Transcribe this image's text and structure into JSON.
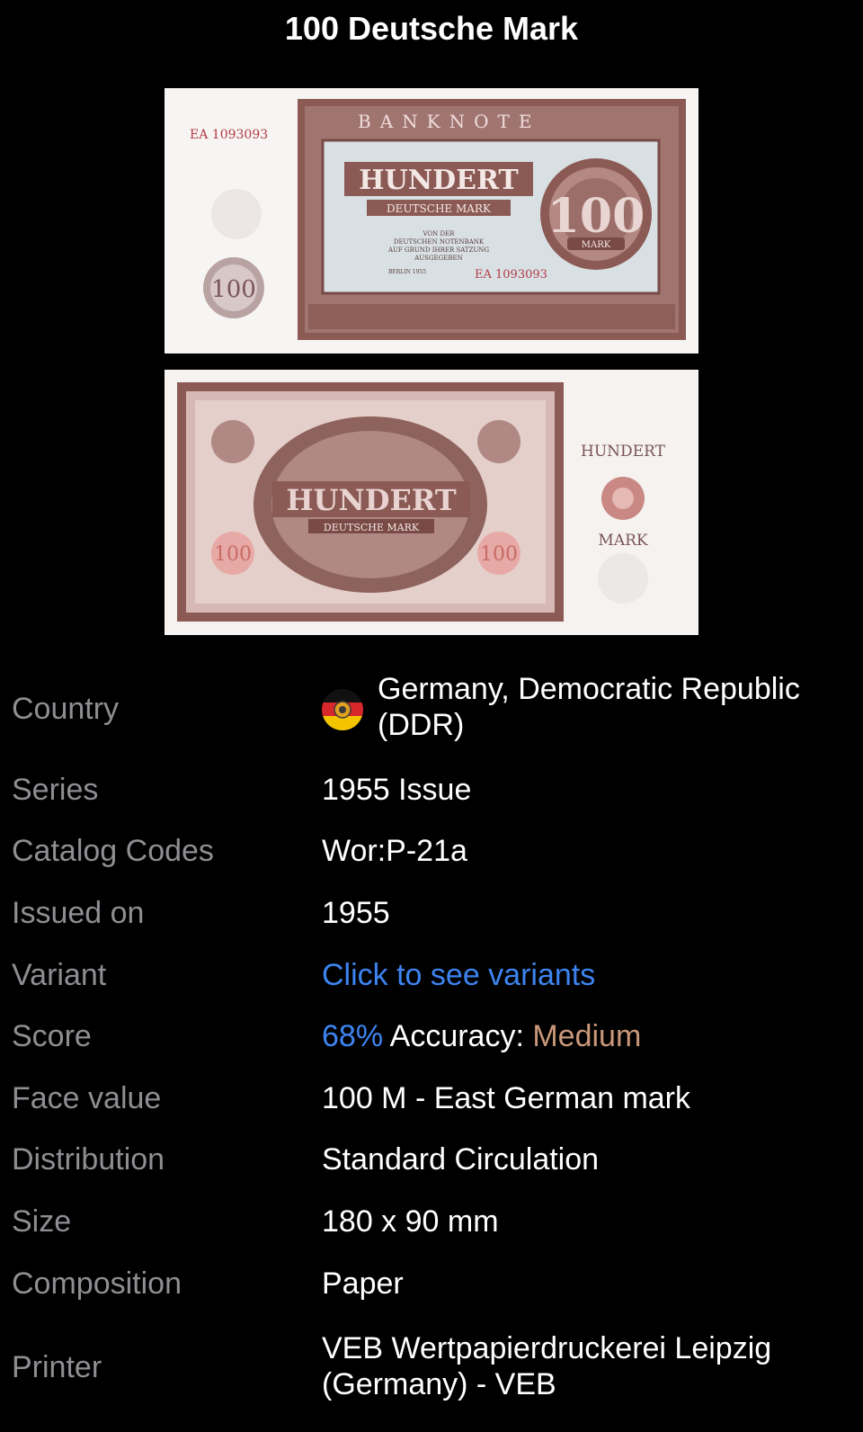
{
  "header": {
    "title": "100 Deutsche Mark"
  },
  "front": {
    "serial": "EA 1093093",
    "serial_inner": "EA 1093093",
    "top_band": "BANKNOTE",
    "word": "HUNDERT",
    "subtitle": "DEUTSCHE MARK",
    "fine_print": [
      "VON DER",
      "DEUTSCHEN NOTENBANK",
      "AUF GRUND IHRER SATZUNG",
      "AUSGEGEBEN"
    ],
    "place": "BERLIN 1955",
    "denomination": "100",
    "mark_label": "MARK",
    "left_denom": "100"
  },
  "back": {
    "word": "HUNDERT",
    "subtitle": "DEUTSCHE MARK",
    "left_denom": "100",
    "right_denom": "100",
    "side_top": "HUNDERT",
    "side_bottom": "MARK"
  },
  "details": {
    "country": {
      "label": "Country",
      "value_line1": "Germany, Democratic Republic",
      "value_line2": "(DDR)",
      "flag_icon": "ddr-flag-icon"
    },
    "series": {
      "label": "Series",
      "value": "1955 Issue"
    },
    "catalog": {
      "label": "Catalog Codes",
      "value": "Wor:P-21a"
    },
    "issued": {
      "label": "Issued on",
      "value": "1955"
    },
    "variant": {
      "label": "Variant",
      "value": "Click to see variants"
    },
    "score": {
      "label": "Score",
      "percent": "68%",
      "accuracy_label": "Accuracy:",
      "accuracy_value": "Medium"
    },
    "face_value": {
      "label": "Face value",
      "value": "100 M - East German mark"
    },
    "distribution": {
      "label": "Distribution",
      "value": "Standard Circulation"
    },
    "size": {
      "label": "Size",
      "value": "180 x 90 mm"
    },
    "composition": {
      "label": "Composition",
      "value": "Paper"
    },
    "printer": {
      "label": "Printer",
      "value_line1": "VEB Wertpapierdruckerei Leipzig",
      "value_line2": "(Germany) - VEB"
    }
  },
  "colors": {
    "link": "#3d84f0",
    "accuracy_medium": "#c9987a",
    "label_gray": "#8e8e93",
    "note_brown": "#8b5a55"
  }
}
